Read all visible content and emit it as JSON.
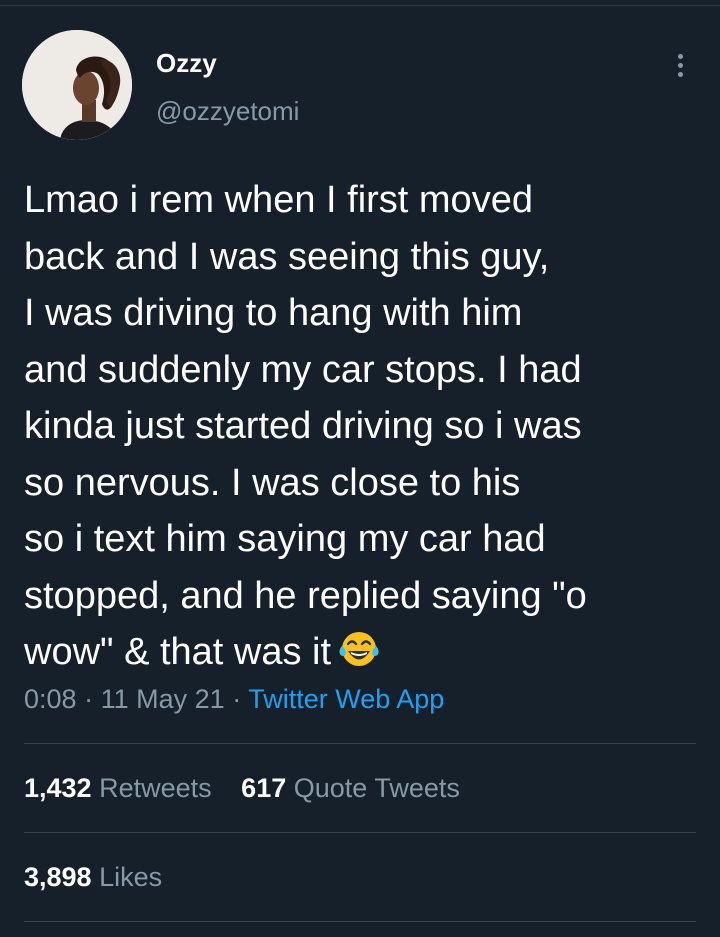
{
  "tweet": {
    "author": {
      "display_name": "Ozzy",
      "handle": "@ozzyetomi"
    },
    "text_lines": [
      "Lmao i rem when I first moved",
      "back and I was seeing this guy,",
      "I was driving to hang with him",
      "and suddenly my car stops. I had",
      "kinda just started driving so i was",
      "so nervous. I was close to his",
      "so i text him saying my car had",
      "stopped, and he replied saying \"o",
      "wow\" & that was it"
    ],
    "emoji": "face-with-tears-of-joy-icon",
    "time": "0:08",
    "date": "11 May 21",
    "source": "Twitter Web App",
    "separator": "·",
    "retweets": {
      "count": "1,432",
      "label": "Retweets"
    },
    "quote_tweets": {
      "count": "617",
      "label": "Quote Tweets"
    },
    "likes": {
      "count": "3,898",
      "label": "Likes"
    }
  },
  "colors": {
    "background": "#15202b",
    "text": "#ffffff",
    "secondary": "#8899a6",
    "link": "#1da1f2",
    "divider": "#38444d"
  }
}
